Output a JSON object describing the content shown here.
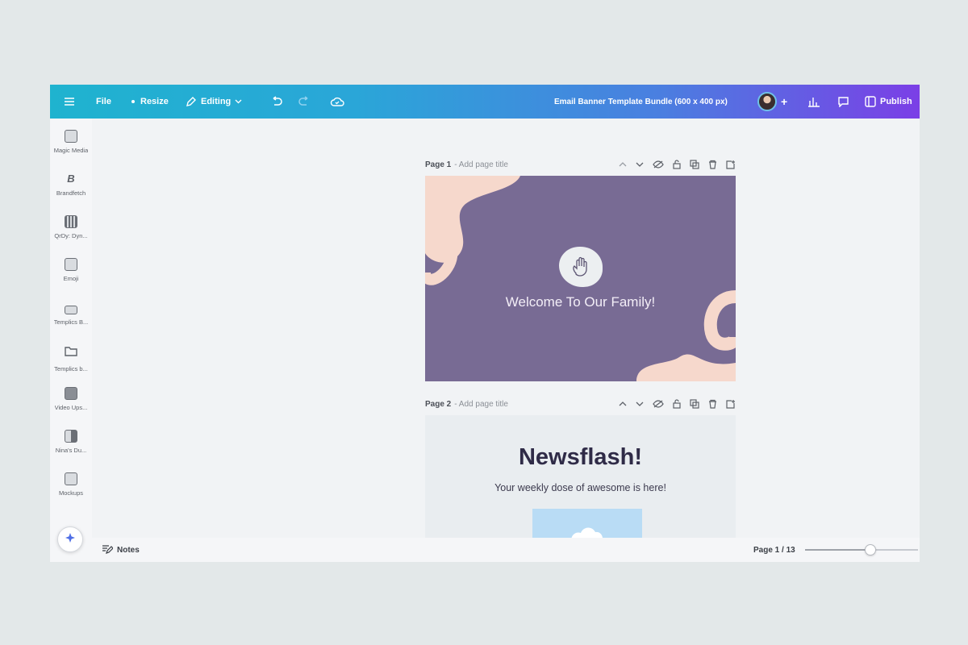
{
  "topbar": {
    "menu_icon": "hamburger-icon",
    "file_label": "File",
    "resize_label": "Resize",
    "editing_label": "Editing",
    "design_title": "Email Banner Template Bundle (600 x 400 px)",
    "publish_label": "Publish",
    "gradient": [
      "#1fb3cf",
      "#4a7fe0",
      "#7b3fe6"
    ]
  },
  "rail": {
    "items": [
      {
        "label": "Magic Media",
        "icon": "magic-media-icon"
      },
      {
        "label": "Brandfetch",
        "icon": "brandfetch-icon"
      },
      {
        "label": "QrDy: Dyn...",
        "icon": "qr-code-icon"
      },
      {
        "label": "Emoji",
        "icon": "emoji-icon"
      },
      {
        "label": "Templics B...",
        "icon": "template-icon"
      },
      {
        "label": "Templics b...",
        "icon": "folder-icon"
      },
      {
        "label": "Video Ups...",
        "icon": "video-upscale-icon"
      },
      {
        "label": "Nina's Du...",
        "icon": "duotone-icon"
      },
      {
        "label": "Mockups",
        "icon": "mockups-icon"
      }
    ]
  },
  "pages": [
    {
      "number_label": "Page 1",
      "title_placeholder": "- Add page title"
    },
    {
      "number_label": "Page 2",
      "title_placeholder": "- Add page title"
    }
  ],
  "page1": {
    "headline": "Welcome To Our Family!",
    "background": "#786b94",
    "blob_color": "#f6d8cc"
  },
  "page2": {
    "headline": "Newsflash!",
    "subtitle": "Your weekly dose of awesome is here!",
    "background": "#e9edf0"
  },
  "bottombar": {
    "notes_label": "Notes",
    "page_indicator": "Page 1 / 13",
    "zoom_fraction": 0.58
  }
}
